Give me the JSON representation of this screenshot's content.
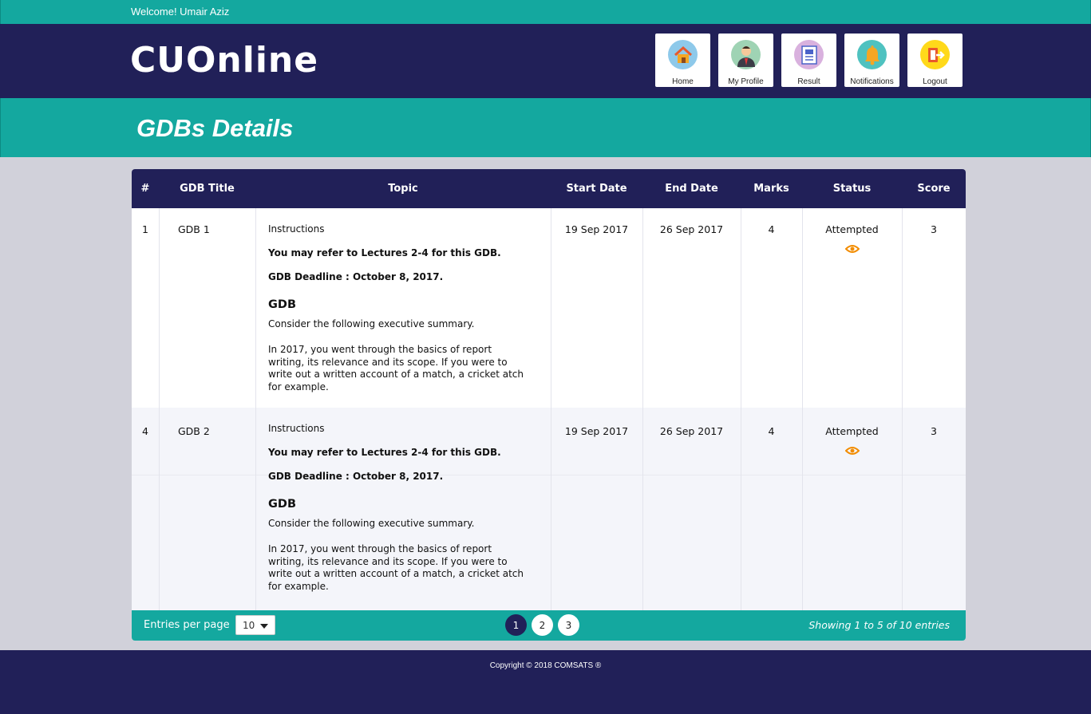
{
  "welcome_text": "Welcome! Umair Aziz",
  "logo_text": "CUOnline",
  "nav": [
    {
      "label": "Home",
      "icon": "home-icon",
      "color": "#8ec9ea"
    },
    {
      "label": "My Profile",
      "icon": "profile-icon",
      "color": "#9fd3b4"
    },
    {
      "label": "Result",
      "icon": "result-icon",
      "color": "#d9b1de"
    },
    {
      "label": "Notifications",
      "icon": "bell-icon",
      "color": "#4fc2c0"
    },
    {
      "label": "Logout",
      "icon": "logout-icon",
      "color": "#ffd91a"
    }
  ],
  "page_title": "GDBs Details",
  "table": {
    "headers": [
      "#",
      "GDB Title",
      "Topic",
      "Start Date",
      "End Date",
      "Marks",
      "Status",
      "Score"
    ],
    "rows": [
      {
        "num": "1",
        "title": "GDB 1",
        "topic": {
          "instructions": "Instructions",
          "refer": "You may refer to Lectures 2-4 for this GDB.",
          "deadline": "GDB Deadline : October 8, 2017.",
          "heading": "GDB",
          "consider": "Consider the following executive summary.",
          "body": "In 2017,  you went through the basics of report writing, its relevance and its scope. If you were to write out a written account of a match, a cricket atch for example."
        },
        "start": "19 Sep 2017",
        "end": "26 Sep 2017",
        "marks": "4",
        "status": "Attempted",
        "score": "3"
      },
      {
        "num": "4",
        "title": "GDB 2",
        "topic": {
          "instructions": "Instructions",
          "refer": "You may refer to Lectures 2-4 for this GDB.",
          "deadline": "GDB Deadline : October 8, 2017.",
          "heading": "GDB",
          "consider": "Consider the following executive summary.",
          "body": "In 2017,  you went through the basics of report writing, its relevance and its scope. If you were to write out a written account of a match, a cricket atch for example."
        },
        "start": "19 Sep 2017",
        "end": "26 Sep 2017",
        "marks": "4",
        "status": "Attempted",
        "score": "3"
      }
    ]
  },
  "footer_bar": {
    "entries_label": "Entries per page",
    "entries_value": "10",
    "pages": [
      "1",
      "2",
      "3"
    ],
    "active_page": "1",
    "showing": "Showing 1 to 5 of 10 entries"
  },
  "copyright": "Copyright © 2018 COMSATS ®",
  "colors": {
    "navy": "#212058",
    "teal": "#14a89f",
    "eye": "#f28c00"
  }
}
